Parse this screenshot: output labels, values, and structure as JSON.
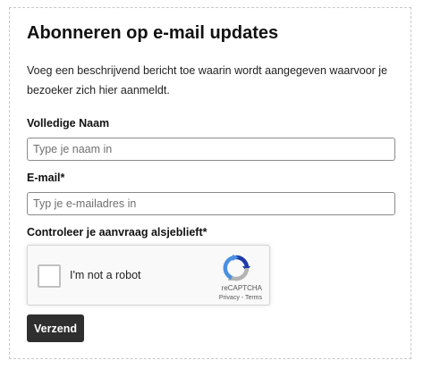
{
  "form": {
    "title": "Abonneren op e-mail updates",
    "description": "Voeg een beschrijvend bericht toe waarin wordt aangegeven waarvoor je bezoeker zich hier aanmeldt.",
    "name_label": "Volledige Naam",
    "name_placeholder": "Type je naam in",
    "name_value": "",
    "email_label": "E-mail*",
    "email_placeholder": "Typ je e-mailadres in",
    "email_value": "",
    "captcha_label": "Controleer je aanvraag alsjeblieft*",
    "submit_label": "Verzend"
  },
  "recaptcha": {
    "checkbox_label": "I'm not a robot",
    "checked": false,
    "brand": "reCAPTCHA",
    "privacy_link": "Privacy",
    "separator": " - ",
    "terms_link": "Terms",
    "logo_icon": "recaptcha-logo-icon"
  },
  "colors": {
    "button_bg": "#2f2f2f",
    "button_text": "#ffffff",
    "input_border": "#8a8a8a",
    "form_border": "#c8c8c8",
    "recaptcha_blue_dark": "#1c3aa9",
    "recaptcha_blue_light": "#4a90e2",
    "recaptcha_gray": "#b3b3b3"
  }
}
